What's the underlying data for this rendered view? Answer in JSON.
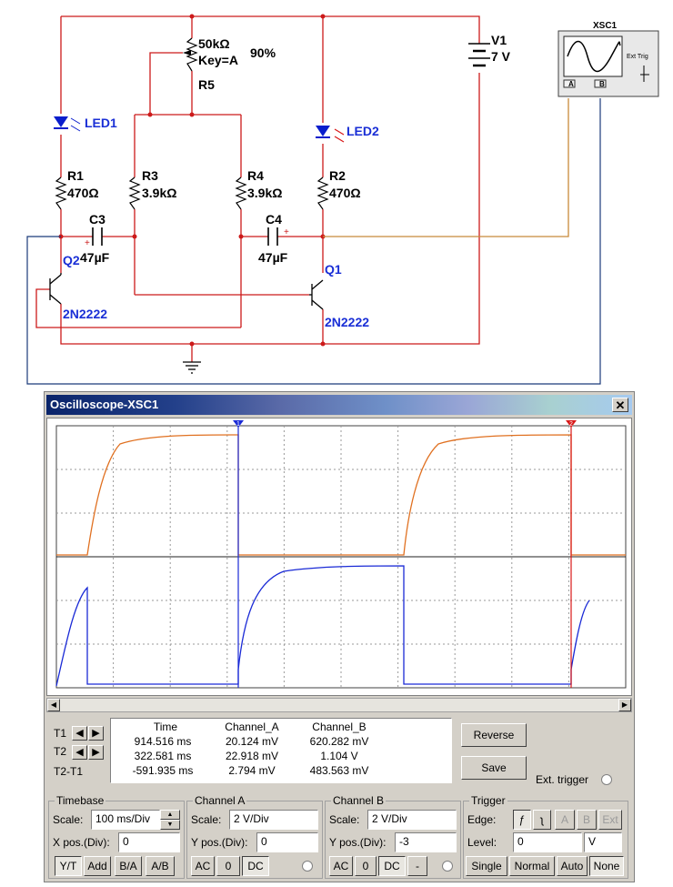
{
  "schematic": {
    "components": {
      "r5_value": "50kΩ",
      "r5_key": "Key=A",
      "r5_percent": "90%",
      "r5_name": "R5",
      "v1_name": "V1",
      "v1_value": "7 V",
      "led1": "LED1",
      "led2": "LED2",
      "r1_name": "R1",
      "r1_value": "470Ω",
      "r3_name": "R3",
      "r3_value": "3.9kΩ",
      "r4_name": "R4",
      "r4_value": "3.9kΩ",
      "r2_name": "R2",
      "r2_value": "470Ω",
      "c3_name": "C3",
      "c3_value": "47µF",
      "c4_name": "C4",
      "c4_value": "47µF",
      "q2_name": "Q2",
      "q2_model": "2N2222",
      "q1_name": "Q1",
      "q1_model": "2N2222",
      "xsc_name": "XSC1",
      "xsc_ext": "Ext Trig",
      "xsc_a": "A",
      "xsc_b": "B"
    },
    "colors": {
      "wire_red": "#cc1a1a",
      "wire_orange": "#c88a3a",
      "wire_navy": "#1a3a7a",
      "label_blue": "#1a2fd6",
      "led_blue": "#0a1ecc"
    }
  },
  "oscilloscope": {
    "title": "Oscilloscope-XSC1",
    "close_label": "✕",
    "cursor_labels": {
      "t1": "1",
      "t2": "2"
    },
    "trace_colors": {
      "channel_a": "#e07020",
      "channel_b": "#1a2ad6",
      "cursor_t1": "#1a2ad6",
      "cursor_t2": "#d81818"
    },
    "readout": {
      "headers": [
        "",
        "Time",
        "Channel_A",
        "Channel_B"
      ],
      "rows": [
        {
          "label": "T1",
          "time": "914.516 ms",
          "a": "20.124 mV",
          "b": "620.282 mV"
        },
        {
          "label": "T2",
          "time": "322.581 ms",
          "a": "22.918 mV",
          "b": "1.104 V"
        },
        {
          "label": "T2-T1",
          "time": "-591.935 ms",
          "a": "2.794 mV",
          "b": "483.563 mV"
        }
      ]
    },
    "buttons": {
      "reverse": "Reverse",
      "save": "Save",
      "ext_trigger": "Ext. trigger"
    },
    "timebase": {
      "title": "Timebase",
      "scale_label": "Scale:",
      "scale_value": "100 ms/Div",
      "xpos_label": "X pos.(Div):",
      "xpos_value": "0",
      "modes": [
        "Y/T",
        "Add",
        "B/A",
        "A/B"
      ]
    },
    "channel_a": {
      "title": "Channel A",
      "scale_label": "Scale:",
      "scale_value": "2  V/Div",
      "ypos_label": "Y pos.(Div):",
      "ypos_value": "0",
      "coupling": [
        "AC",
        "0",
        "DC"
      ]
    },
    "channel_b": {
      "title": "Channel B",
      "scale_label": "Scale:",
      "scale_value": "2  V/Div",
      "ypos_label": "Y pos.(Div):",
      "ypos_value": "-3",
      "coupling": [
        "AC",
        "0",
        "DC",
        "-"
      ]
    },
    "trigger": {
      "title": "Trigger",
      "edge_label": "Edge:",
      "edge_buttons": [
        "ƒ",
        "ʅ"
      ],
      "source_buttons": [
        "A",
        "B",
        "Ext"
      ],
      "level_label": "Level:",
      "level_value": "0",
      "level_unit": "V",
      "modes": [
        "Single",
        "Normal",
        "Auto",
        "None"
      ]
    }
  }
}
